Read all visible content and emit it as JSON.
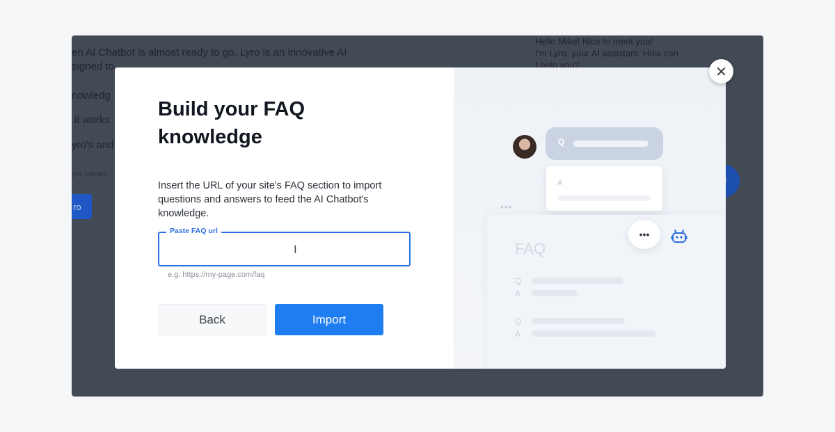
{
  "background": {
    "lines": [
      "en AI Chatbot is almost ready to go. Lyro is an innovative AI",
      "signed to",
      "nowledg",
      "it works",
      "yro's and",
      "yro curren"
    ],
    "button_label": "ro",
    "chat_lines": [
      "Hello Mike! Nice to meet you!",
      "I'm Lyro, your AI assistant. How can",
      "I help you?"
    ]
  },
  "modal": {
    "title": "Build your FAQ knowledge",
    "description": "Insert the URL of your site's FAQ section to import questions and answers to feed the AI Chatbot's knowledge.",
    "field_label": "Paste FAQ url",
    "field_value": "",
    "helper_text": "e.g. https://my-page.com/faq",
    "back_label": "Back",
    "import_label": "Import",
    "close_glyph": "✕"
  },
  "illustration": {
    "q_label": "Q",
    "a_label": "A",
    "faq_title": "FAQ",
    "rows": [
      {
        "q": "Q",
        "a": "A"
      },
      {
        "q": "Q",
        "a": "A"
      }
    ],
    "ellipsis": "•••",
    "dots": "•••"
  },
  "icons": {
    "close": "close-icon",
    "bot": "bot-icon",
    "cursor": "text-cursor-icon"
  },
  "colors": {
    "accent": "#1f7df2",
    "field_border": "#2c6fe0",
    "overlay": "#424a56"
  }
}
